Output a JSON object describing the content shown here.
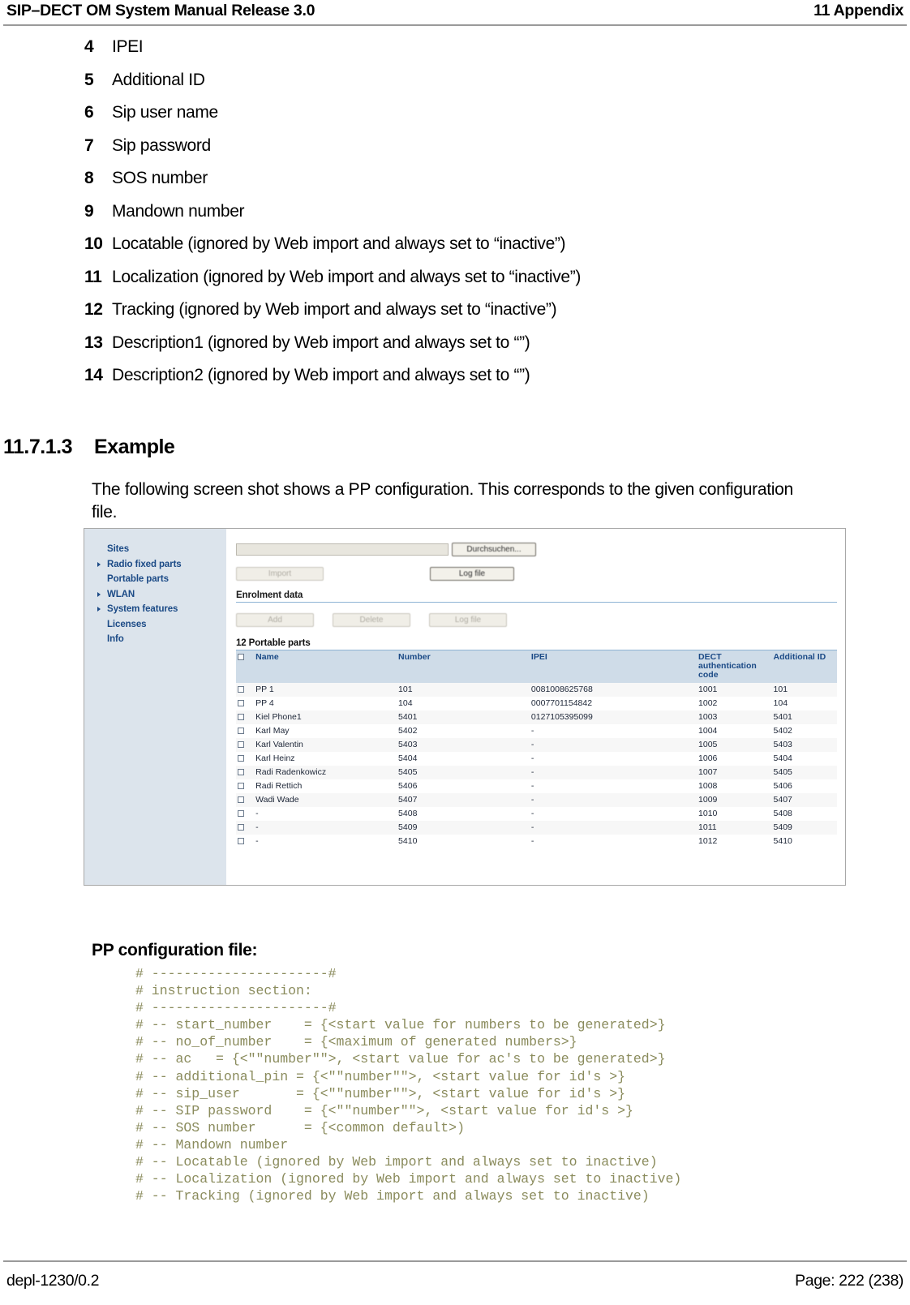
{
  "header": {
    "left": "SIP–DECT OM System Manual Release 3.0",
    "right": "11 Appendix"
  },
  "numbered_list": [
    {
      "num": "4",
      "text": "IPEI"
    },
    {
      "num": "5",
      "text": "Additional ID"
    },
    {
      "num": "6",
      "text": "Sip user name"
    },
    {
      "num": "7",
      "text": "Sip password"
    },
    {
      "num": "8",
      "text": "SOS number"
    },
    {
      "num": "9",
      "text": "Mandown number"
    },
    {
      "num": "10",
      "text": "Locatable (ignored by Web import and always set to “inactive”)"
    },
    {
      "num": "11",
      "text": "Localization (ignored by Web import and always set to “inactive”)"
    },
    {
      "num": "12",
      "text": "Tracking (ignored by Web import and always set to “inactive”)"
    },
    {
      "num": "13",
      "text": "Description1 (ignored by Web import and always set to “”)"
    },
    {
      "num": "14",
      "text": "Description2 (ignored by Web import and always set to “”)"
    }
  ],
  "section": {
    "number": "11.7.1.3",
    "title": "Example",
    "intro": "The following screen shot shows a PP configuration. This corresponds to the given configuration file."
  },
  "screenshot": {
    "sidebar": [
      {
        "label": "Sites",
        "expandable": false
      },
      {
        "label": "Radio fixed parts",
        "expandable": true
      },
      {
        "label": "Portable parts",
        "expandable": false
      },
      {
        "label": "WLAN",
        "expandable": true
      },
      {
        "label": "System features",
        "expandable": true
      },
      {
        "label": "Licenses",
        "expandable": false
      },
      {
        "label": "Info",
        "expandable": false
      }
    ],
    "file_input_value": "",
    "buttons": {
      "browse": "Durchsuchen...",
      "import": "Import",
      "log_file_top": "Log file",
      "add": "Add",
      "delete": "Delete",
      "log_file_bottom": "Log file"
    },
    "enrolment_label": "Enrolment data",
    "pp_count_label": "12 Portable parts",
    "table": {
      "columns": [
        "Name",
        "Number",
        "IPEI",
        "DECT authentication code",
        "Additional ID"
      ],
      "col_dect_line1": "DECT",
      "col_dect_line2": "authentication",
      "col_dect_line3": "code",
      "rows": [
        {
          "name": "PP 1",
          "number": "101",
          "ipei": "0081008625768",
          "dect": "1001",
          "addid": "101"
        },
        {
          "name": "PP 4",
          "number": "104",
          "ipei": "0007701154842",
          "dect": "1002",
          "addid": "104"
        },
        {
          "name": "Kiel Phone1",
          "number": "5401",
          "ipei": "0127105395099",
          "dect": "1003",
          "addid": "5401"
        },
        {
          "name": "Karl May",
          "number": "5402",
          "ipei": "-",
          "dect": "1004",
          "addid": "5402"
        },
        {
          "name": "Karl Valentin",
          "number": "5403",
          "ipei": "-",
          "dect": "1005",
          "addid": "5403"
        },
        {
          "name": "Karl Heinz",
          "number": "5404",
          "ipei": "-",
          "dect": "1006",
          "addid": "5404"
        },
        {
          "name": "Radi Radenkowicz",
          "number": "5405",
          "ipei": "-",
          "dect": "1007",
          "addid": "5405"
        },
        {
          "name": "Radi Rettich",
          "number": "5406",
          "ipei": "-",
          "dect": "1008",
          "addid": "5406"
        },
        {
          "name": "Wadi Wade",
          "number": "5407",
          "ipei": "-",
          "dect": "1009",
          "addid": "5407"
        },
        {
          "name": "-",
          "number": "5408",
          "ipei": "-",
          "dect": "1010",
          "addid": "5408"
        },
        {
          "name": "-",
          "number": "5409",
          "ipei": "-",
          "dect": "1011",
          "addid": "5409"
        },
        {
          "name": "-",
          "number": "5410",
          "ipei": "-",
          "dect": "1012",
          "addid": "5410"
        }
      ]
    }
  },
  "config_file": {
    "title": "PP configuration file:",
    "code": "# ----------------------#\n# instruction section:\n# ----------------------#\n# -- start_number    = {<start value for numbers to be generated>}\n# -- no_of_number    = {<maximum of generated numbers>}\n# -- ac   = {<\"\"number\"\">, <start value for ac's to be generated>}\n# -- additional_pin = {<\"\"number\"\">, <start value for id's >}\n# -- sip_user       = {<\"\"number\"\">, <start value for id's >}\n# -- SIP password    = {<\"\"number\"\">, <start value for id's >}\n# -- SOS number      = {<common default>)\n# -- Mandown number\n# -- Locatable (ignored by Web import and always set to inactive)\n# -- Localization (ignored by Web import and always set to inactive)\n# -- Tracking (ignored by Web import and always set to inactive)"
  },
  "footer": {
    "left": "depl-1230/0.2",
    "right": "Page: 222 (238)"
  },
  "colors": {
    "sidebar_bg": "#dce4ec",
    "link_blue": "#1b4a86",
    "table_header_bg": "#cfdce8",
    "code_olive": "#8a8b5c",
    "rule_gray": "#9a9a9a"
  }
}
